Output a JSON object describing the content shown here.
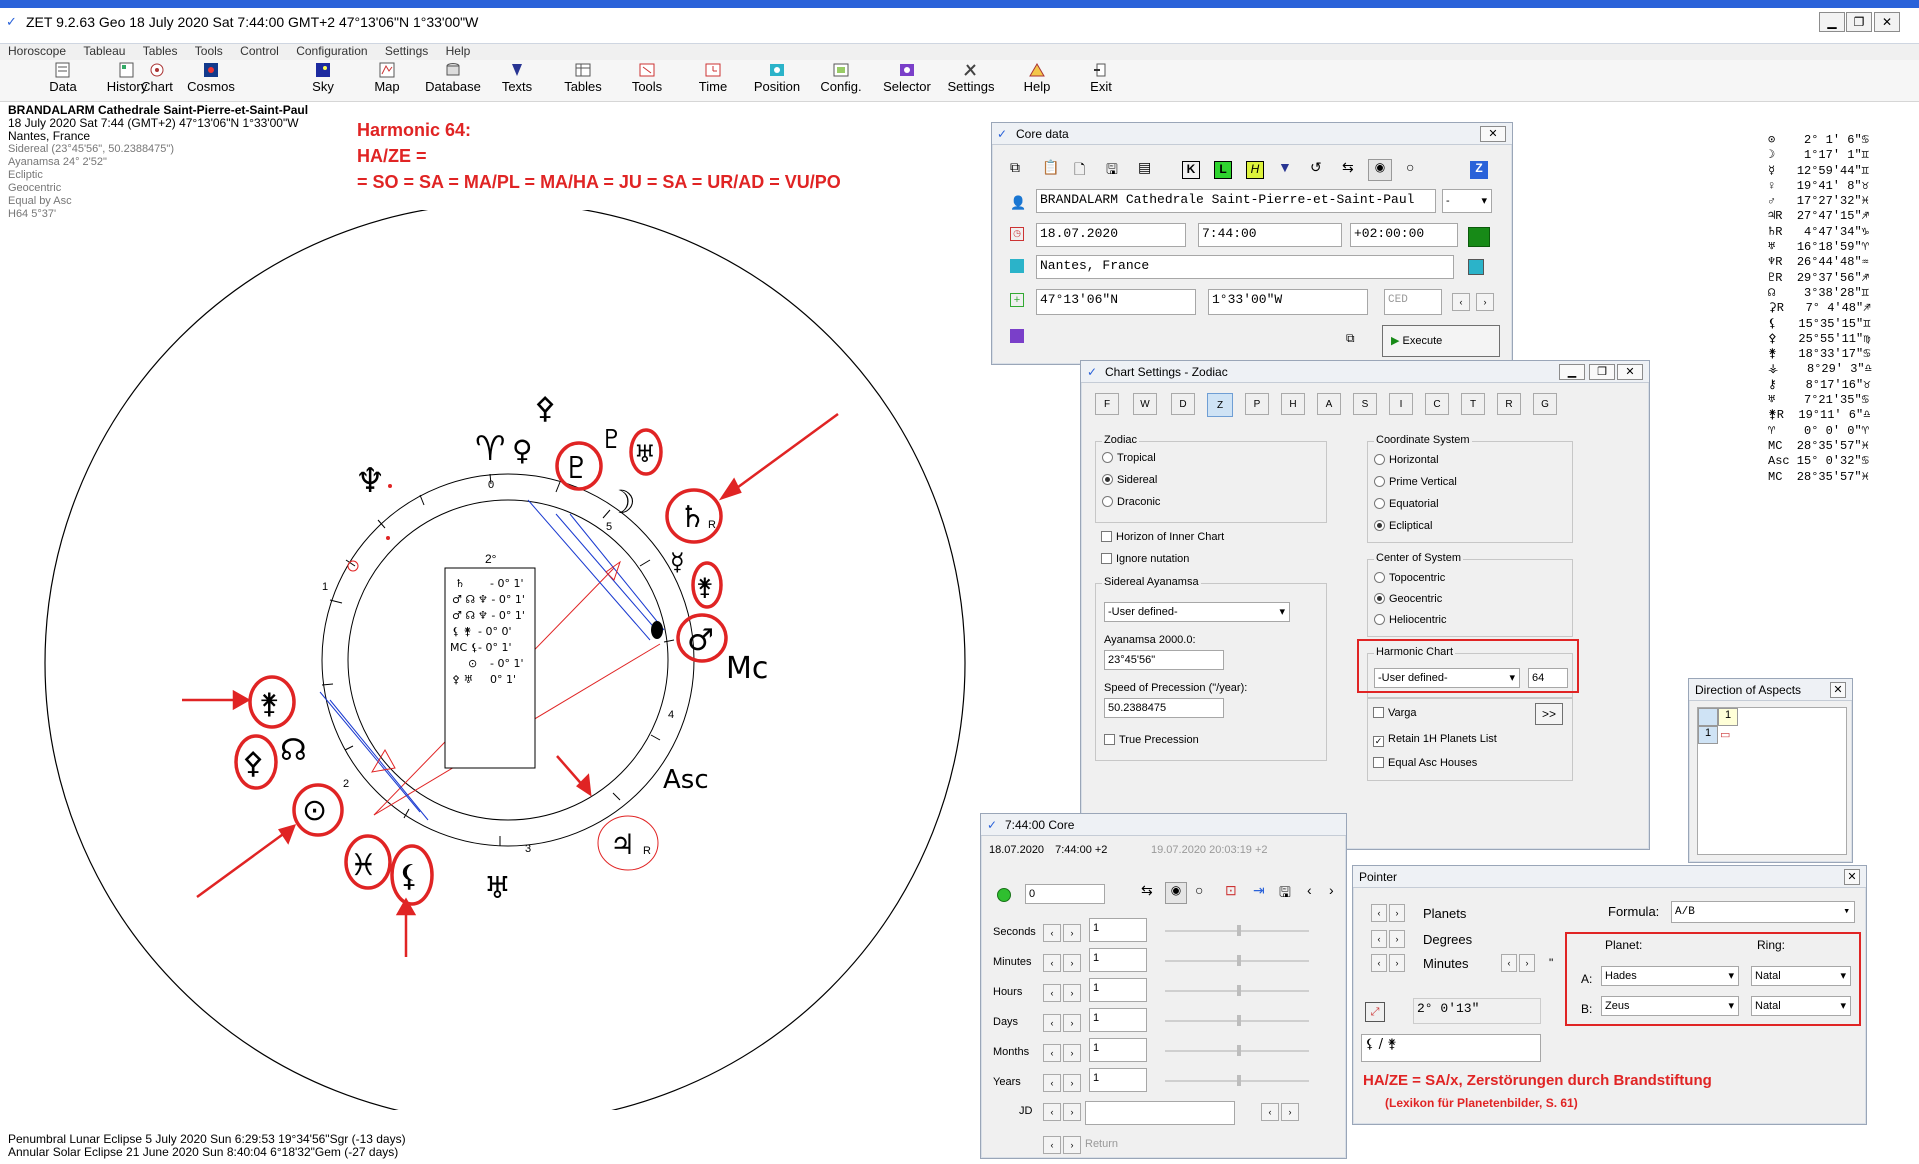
{
  "window": {
    "title": "ZET 9.2.63 Geo    18 July 2020  Sat    7:44:00 GMT+2 47°13'06\"N  1°33'00\"W"
  },
  "menu": [
    "Horoscope",
    "Tableau",
    "Tables",
    "Tools",
    "Control",
    "Configuration",
    "Settings",
    "Help"
  ],
  "toolbar": [
    "Data",
    "History",
    "Chart",
    "Cosmos",
    "Sky",
    "Map",
    "Database",
    "Texts",
    "Tables",
    "Tools",
    "Time",
    "Position",
    "Config.",
    "Selector",
    "Settings",
    "Help",
    "Exit"
  ],
  "chart_info": {
    "name": "BRANDALARM Cathedrale Saint-Pierre-et-Saint-Paul",
    "datetime": "18 July 2020  Sat   7:44 (GMT+2) 47°13'06\"N  1°33'00\"W",
    "place": "Nantes, France",
    "details": [
      "Sidereal (23°45'56\", 50.2388475\")",
      "Ayanamsa 24° 2'52\"",
      "Ecliptic",
      "Geocentric",
      "Equal by Asc",
      "H64  5°37'"
    ]
  },
  "harmonic": {
    "line1": "Harmonic 64:",
    "line2": "HA/ZE =",
    "line3": "= SO = SA = MA/PL = MA/HA = JU = SA = UR/AD = VU/PO"
  },
  "wheel": {
    "center_label": "2°",
    "aspect_table": [
      [
        "♄",
        "- 0° 1'"
      ],
      [
        "♂ ☊",
        "♆ - 0° 1'"
      ],
      [
        "♂ ☊",
        "♆ - 0° 1'"
      ],
      [
        "⚸ ⚵",
        "- 0° 0'"
      ],
      [
        "MC ⚸",
        "- 0° 1'"
      ],
      [
        "⊙",
        "- 0° 1'"
      ],
      [
        "⚴ ♅",
        "0° 1'"
      ]
    ],
    "house_numbers": [
      "1",
      "2",
      "3",
      "4",
      "5",
      "0"
    ],
    "labels": {
      "mc": "Mc",
      "asc": "Asc",
      "ju_r": "R"
    }
  },
  "core_data": {
    "title": "Core data",
    "name": "BRANDALARM Cathedrale Saint-Pierre-et-Saint-Paul",
    "name_combo": "-",
    "date": "18.07.2020",
    "time": "7:44:00",
    "zone": "+02:00:00",
    "place": "Nantes, France",
    "lat": "47°13'06\"N",
    "lon": "1°33'00\"W",
    "zone_code": "CED",
    "execute": "Execute"
  },
  "chart_settings": {
    "title": "Chart Settings - Zodiac",
    "zodiac_label": "Zodiac",
    "zodiac_options": [
      "Tropical",
      "Sidereal",
      "Draconic"
    ],
    "zodiac_selected": 1,
    "horizon_inner": "Horizon of Inner Chart",
    "ignore_nutation": "Ignore nutation",
    "sidereal_label": "Sidereal Ayanamsa",
    "sidereal_value": "-User defined-",
    "ayanamsa_label": "Ayanamsa 2000.0:",
    "ayanamsa_value": "23°45'56\"",
    "speed_label": "Speed of Precession (\"/year):",
    "speed_value": "50.2388475",
    "true_precession": "True Precession",
    "coord_label": "Coordinate System",
    "coord_options": [
      "Horizontal",
      "Prime Vertical",
      "Equatorial",
      "Ecliptical"
    ],
    "coord_selected": 3,
    "center_label": "Center of System",
    "center_options": [
      "Topocentric",
      "Geocentric",
      "Heliocentric"
    ],
    "center_selected": 1,
    "harmonic_label": "Harmonic Chart",
    "harmonic_combo": "-User defined-",
    "harmonic_value": "64",
    "varga": "Varga",
    "varga_btn": ">>",
    "retain": "Retain 1H Planets List",
    "equal_asc": "Equal Asc Houses",
    "tab_letters": [
      "F",
      "W",
      "D",
      "Z",
      "P",
      "H",
      "A",
      "S",
      "I",
      "C",
      "T",
      "R",
      "G"
    ]
  },
  "core_time": {
    "title": "7:44:00 Core",
    "date": "18.07.2020",
    "time": "7:44:00 +2",
    "date2": "19.07.2020  20:03:19 +2",
    "step_value": "0",
    "rows": [
      {
        "label": "Seconds",
        "value": "1"
      },
      {
        "label": "Minutes",
        "value": "1"
      },
      {
        "label": "Hours",
        "value": "1"
      },
      {
        "label": "Days",
        "value": "1"
      },
      {
        "label": "Months",
        "value": "1"
      },
      {
        "label": "Years",
        "value": "1"
      }
    ],
    "jd_label": "JD",
    "return_label": "Return"
  },
  "aspects": {
    "title": "Direction of Aspects",
    "col": "1",
    "row": "1"
  },
  "pointer": {
    "title": "Pointer",
    "planets": "Planets",
    "degrees": "Degrees",
    "minutes": "Minutes",
    "minutes_sym": "\"",
    "formula_label": "Formula:",
    "formula_value": "A/B",
    "planet_col": "Planet:",
    "ring_col": "Ring:",
    "row_a": "A:",
    "row_b": "B:",
    "planet_a": "Hades",
    "planet_b": "Zeus",
    "ring_a": "Natal",
    "ring_b": "Natal",
    "result": "2° 0'13\"",
    "formula_display": "⚸ / ⚵"
  },
  "annotation": {
    "main": "HA/ZE = SA/x, Zerstörungen durch Brandstiftung",
    "source": "(Lexikon für Planetenbilder, S. 61)"
  },
  "planet_list": [
    "⊙    2° 1' 6\"♋",
    "☽    1°17' 1\"♊",
    "☿   12°59'44\"♊",
    "♀   19°41' 8\"♉",
    "♂   17°27'32\"♓",
    "♃R  27°47'15\"♐",
    "♄R   4°47'34\"♑",
    "♅   16°18'59\"♈",
    "♆R  26°44'48\"♒",
    "♇R  29°37'56\"♐",
    "☊    3°38'28\"♊",
    "⚳R   7° 4'48\"♐",
    "⚸   15°35'15\"♊",
    "⚴   25°55'11\"♍",
    "⚵   18°33'17\"♋",
    "⚶    8°29' 3\"♎",
    "⚷    8°17'16\"♉",
    "♅    7°21'35\"♋",
    "⚵R  19°11' 6\"♎",
    "♈    0° 0' 0\"♈",
    "MC  28°35'57\"♓",
    "Asc 15° 0'32\"♋",
    "MC  28°35'57\"♓"
  ],
  "eclipses": [
    "Penumbral Lunar Eclipse 5 July 2020 Sun  6:29:53 19°34'56\"Sgr (-13 days)",
    "Annular Solar Eclipse 21 June 2020 Sun  8:40:04  6°18'32\"Gem (-27 days)"
  ]
}
